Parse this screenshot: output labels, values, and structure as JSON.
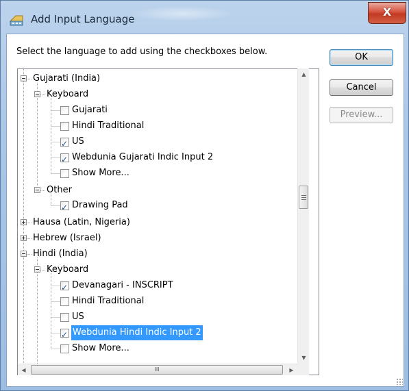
{
  "window": {
    "title": "Add Input Language",
    "close_label": "X"
  },
  "instruction": "Select the language to add using the checkboxes below.",
  "buttons": {
    "ok": "OK",
    "cancel": "Cancel",
    "preview": "Preview..."
  },
  "tree": {
    "languages": [
      {
        "label": "Gujarati (India)",
        "expanded": true,
        "groups": [
          {
            "label": "Keyboard",
            "items": [
              {
                "label": "Gujarati",
                "checked": false
              },
              {
                "label": "Hindi Traditional",
                "checked": false
              },
              {
                "label": "US",
                "checked": true
              },
              {
                "label": "Webdunia Gujarati Indic Input 2",
                "checked": true
              },
              {
                "label": "Show More...",
                "checked": false
              }
            ]
          },
          {
            "label": "Other",
            "items": [
              {
                "label": "Drawing Pad",
                "checked": true
              }
            ]
          }
        ]
      },
      {
        "label": "Hausa (Latin, Nigeria)",
        "expanded": false
      },
      {
        "label": "Hebrew (Israel)",
        "expanded": false
      },
      {
        "label": "Hindi (India)",
        "expanded": true,
        "groups": [
          {
            "label": "Keyboard",
            "items": [
              {
                "label": "Devanagari - INSCRIPT",
                "checked": true
              },
              {
                "label": "Hindi Traditional",
                "checked": false
              },
              {
                "label": "US",
                "checked": false
              },
              {
                "label": "Webdunia Hindi Indic Input 2",
                "checked": true,
                "selected": true
              },
              {
                "label": "Show More...",
                "checked": false
              }
            ]
          }
        ]
      }
    ]
  },
  "scrollbar": {
    "vertical_grip_glyph": "≡",
    "horizontal_grip_glyph": "III"
  },
  "colors": {
    "selection": "#3399ff",
    "close_button": "#c23a22",
    "checkmark": "#1d4f91"
  }
}
